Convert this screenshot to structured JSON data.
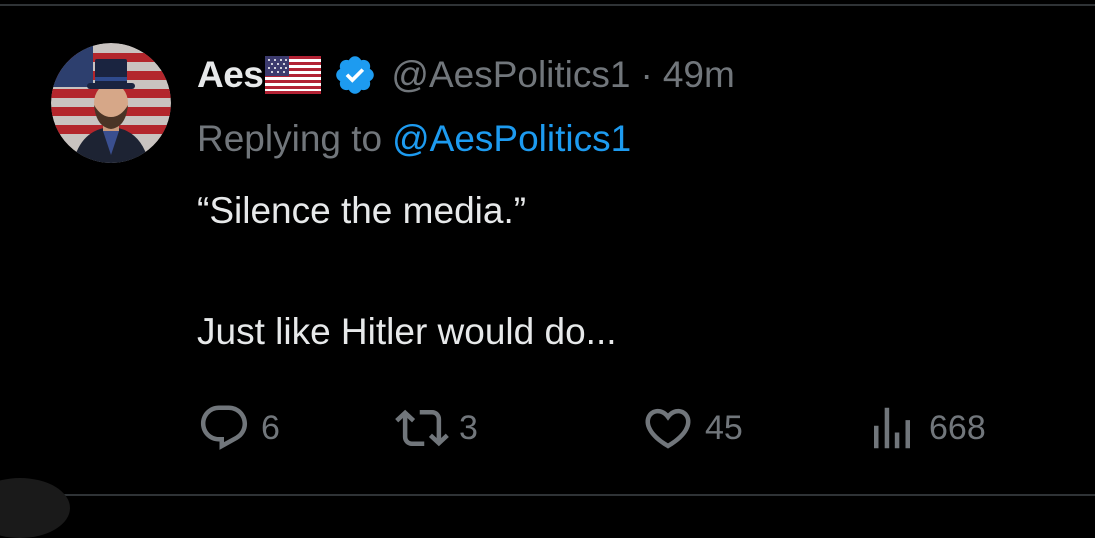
{
  "tweet": {
    "display_name": "Aes",
    "flag_icon": "us-flag-icon",
    "verified_icon": "verified-badge-icon",
    "verified_color": "#1d9bf0",
    "handle": "@AesPolitics1",
    "separator": "·",
    "time": "49m",
    "replying_to_label": "Replying to",
    "replying_to_handle": "@AesPolitics1",
    "text_line_1": "“Silence the media.”",
    "text_line_2": "Just like Hitler would do..."
  },
  "actions": {
    "reply": {
      "icon": "comment-icon",
      "count": "6"
    },
    "repost": {
      "icon": "retweet-icon",
      "count": "3"
    },
    "like": {
      "icon": "heart-icon",
      "count": "45"
    },
    "views": {
      "icon": "analytics-icon",
      "count": "668"
    }
  },
  "colors": {
    "background": "#000000",
    "text_primary": "#e7e9ea",
    "text_secondary": "#71767b",
    "link": "#1d9bf0",
    "divider": "#2f3336"
  }
}
